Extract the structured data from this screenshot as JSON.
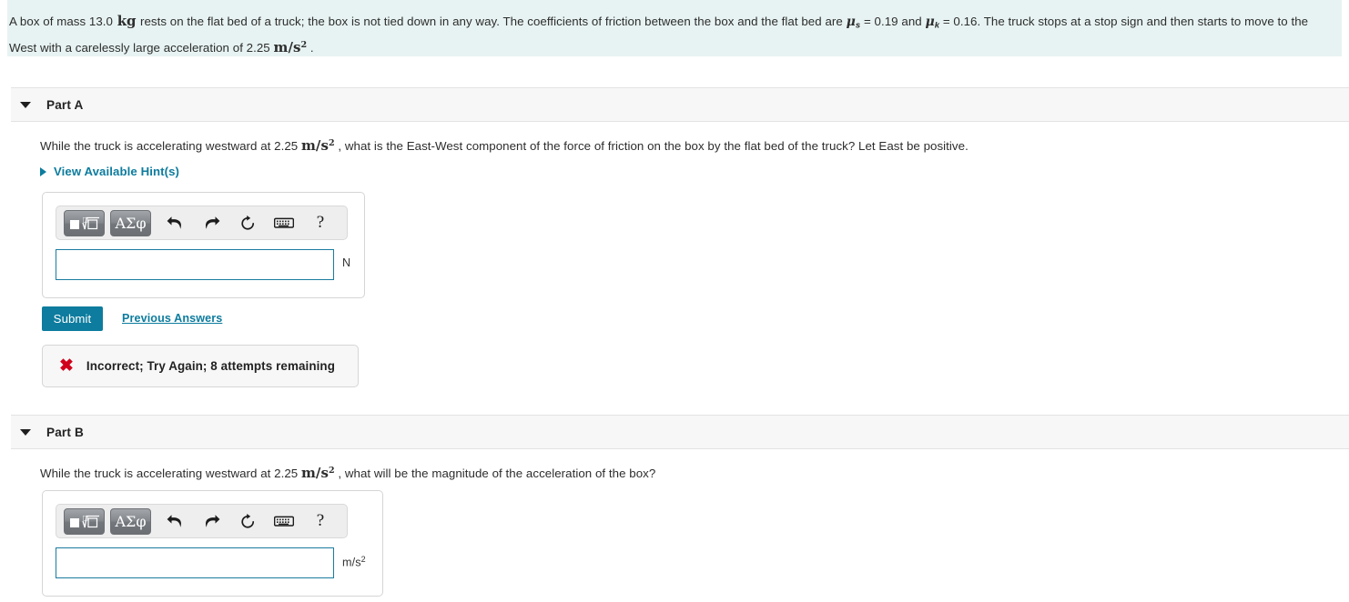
{
  "problem": {
    "part1": "A box of mass 13.0",
    "mass_unit": "kg",
    "part2": "rests on the flat bed of a truck; the box is not tied down in any way. The coefficients of friction between the box and the flat bed are",
    "mu_s_symbol": "μ",
    "mu_s_sub": "s",
    "mu_s_value": "= 0.19 and",
    "mu_k_symbol": "μ",
    "mu_k_sub": "k",
    "mu_k_value": "= 0.16. The truck stops at a stop sign and then starts to move to the West",
    "part3": "with a carelessly large acceleration of 2.25",
    "accel_unit_num": "m",
    "accel_unit_den": "s",
    "accel_unit_exp": "2",
    "part4": "."
  },
  "parts": [
    {
      "title": "Part A",
      "question_pre": "While the truck is accelerating westward at 2.25",
      "question_unit_num": "m",
      "question_unit_den": "s",
      "question_unit_exp": "2",
      "question_post": ", what is the East-West component of the force of friction on the box by the flat bed of the truck? Let East be positive.",
      "hints_label": "View Available Hint(s)",
      "answer_value": "",
      "answer_placeholder": "",
      "unit": "N",
      "has_unit_exponent": false,
      "submit_label": "Submit",
      "previous_answers_label": "Previous Answers",
      "feedback": {
        "icon": "x-mark-icon",
        "text": "Incorrect; Try Again; 8 attempts remaining"
      }
    },
    {
      "title": "Part B",
      "question_pre": "While the truck is accelerating westward at 2.25",
      "question_unit_num": "m",
      "question_unit_den": "s",
      "question_unit_exp": "2",
      "question_post": ", what will be the magnitude of the acceleration of the box?",
      "answer_value": "",
      "answer_placeholder": "",
      "unit": "m/s",
      "unit_exp": "2",
      "has_unit_exponent": true
    }
  ],
  "mathbar": {
    "template_button": "template-tool",
    "greek_button": "ΑΣφ",
    "undo": "undo-icon",
    "redo": "redo-icon",
    "reset": "reset-icon",
    "keyboard": "keyboard-icon",
    "help": "?"
  },
  "colors": {
    "accent": "#0d7c9e",
    "banner_bg": "#e7f3f2",
    "header_bg": "#f7f7f8",
    "error": "#d0021b",
    "input_border": "#1a7ba0"
  }
}
